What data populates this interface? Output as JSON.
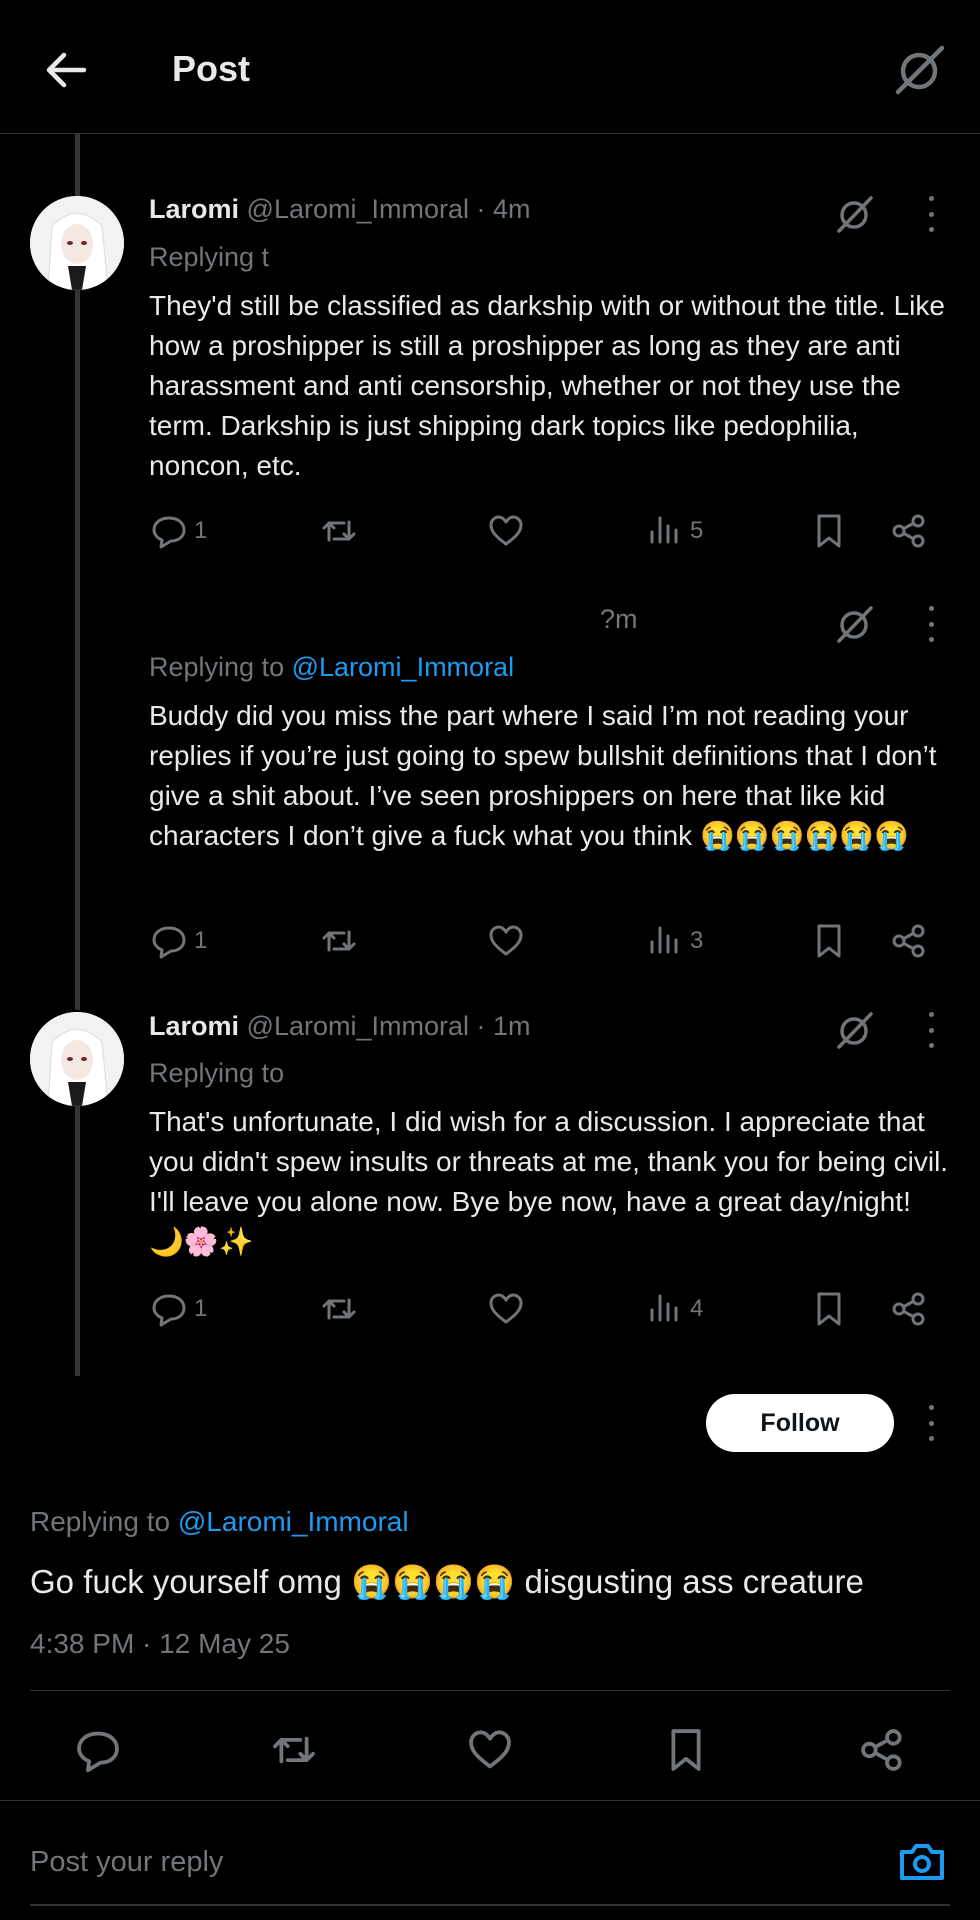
{
  "header": {
    "title": "Post"
  },
  "tweets": [
    {
      "name": "Laromi",
      "meta": "@Laromi_Immoral · 4m",
      "replying_prefix": "Replying t",
      "replying_handle": "",
      "text": "They'd still be classified as darkship with or without the title. Like how a proshipper is still a proshipper as long as they are anti harassment and anti censorship, whether or not they use the term. Darkship is just shipping dark topics like pedophilia, noncon, etc.",
      "replies": "1",
      "views": "5"
    },
    {
      "name": "",
      "meta": "?m",
      "replying_prefix": "Replying to",
      "replying_handle": "@Laromi_Immoral",
      "text": "Buddy did you miss the part where I said I’m not reading your replies if you’re just going to spew bullshit definitions that I don’t give a shit about. I’ve seen proshippers on here that like kid characters I don’t give a fuck what you think 😭😭😭😭😭😭",
      "replies": "1",
      "views": "3"
    },
    {
      "name": "Laromi",
      "meta": "@Laromi_Immoral · 1m",
      "replying_prefix": "Replying to",
      "replying_handle": "",
      "text": "That's unfortunate, I did wish for a discussion. I appreciate that you didn't spew insults or threats at me, thank you for being civil. I'll leave you alone now. Bye bye now, have a great day/night! 🌙🌸✨",
      "replies": "1",
      "views": "4"
    }
  ],
  "main_post": {
    "follow_label": "Follow",
    "replying_prefix": "Replying to",
    "replying_handle": "@Laromi_Immoral",
    "text": "Go fuck yourself omg 😭😭😭😭 disgusting ass creature",
    "timestamp": "4:38 PM · 12 May 25"
  },
  "composer": {
    "placeholder": "Post your reply"
  },
  "icons": {
    "back": "arrow-left-icon",
    "grok": "grok-icon",
    "reply": "reply-icon",
    "retweet": "retweet-icon",
    "like": "heart-icon",
    "views": "views-icon",
    "bookmark": "bookmark-icon",
    "share": "share-icon",
    "camera": "camera-icon",
    "more": "more-icon"
  },
  "colors": {
    "background": "#000000",
    "text": "#e7e9ea",
    "muted": "#71767b",
    "accent": "#1d9bf0"
  }
}
